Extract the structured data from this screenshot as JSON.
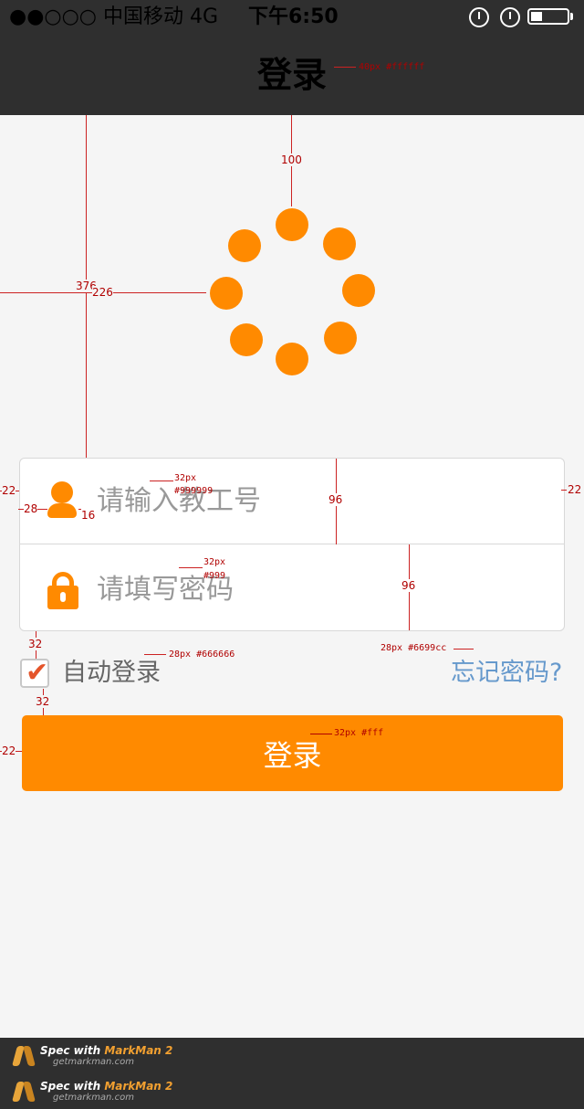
{
  "status_bar": {
    "signal": "●●○○○ 中国移动  4G",
    "time": "下午6:50"
  },
  "nav": {
    "title": "登录"
  },
  "form": {
    "id_placeholder": "请输入教工号",
    "password_placeholder": "请填写密码",
    "auto_login_label": "自动登录",
    "auto_login_checked": true,
    "forgot_label": "忘记密码?",
    "login_label": "登录"
  },
  "spec": {
    "title_note": "40px #ffffff",
    "gap_top": "100",
    "gap_376": "376",
    "gap_226": "226",
    "margin_left_22": "22",
    "margin_right_22": "22",
    "icon_28": "28",
    "icon_16": "16",
    "id_note_size": "32px",
    "id_note_color": "#999999",
    "pwd_note_size": "32px",
    "pwd_note_color": "#999",
    "row_height_1": "96",
    "row_height_2": "96",
    "gap_32_top": "32",
    "gap_32_bottom": "32",
    "auto_note": "28px #666666",
    "forgot_note": "28px #6699cc",
    "button_margin_22": "22",
    "button_note": "32px #fff"
  },
  "footer": {
    "items": [
      {
        "prefix": "Spec with ",
        "brand": "MarkMan 2",
        "site": "getmarkman.com"
      },
      {
        "prefix": "Spec with ",
        "brand": "MarkMan 2",
        "site": "getmarkman.com"
      }
    ]
  },
  "colors": {
    "accent": "#ff8a00",
    "bar": "#2f2f2f",
    "link": "#6699cc",
    "placeholder": "#999999",
    "label": "#666666"
  },
  "icons": [
    "user-icon",
    "lock-icon",
    "checkmark-icon",
    "battery-icon",
    "alarm-icon",
    "rotation-lock-icon",
    "markman-logo"
  ]
}
